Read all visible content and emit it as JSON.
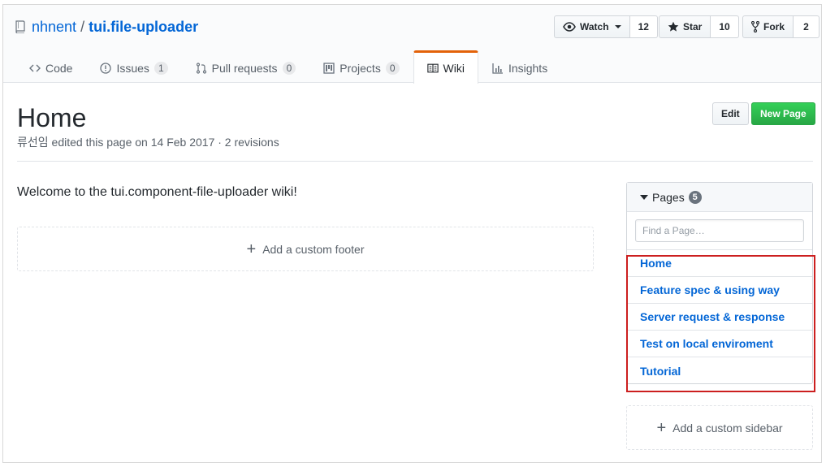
{
  "repo": {
    "owner": "nhnent",
    "separator": "/",
    "name": "tui.file-uploader"
  },
  "actions": {
    "watch_label": "Watch",
    "watch_count": "12",
    "star_label": "Star",
    "star_count": "10",
    "fork_label": "Fork",
    "fork_count": "2"
  },
  "tabs": [
    {
      "label": "Code",
      "icon": "code-icon"
    },
    {
      "label": "Issues",
      "count": "1",
      "icon": "issue-icon"
    },
    {
      "label": "Pull requests",
      "count": "0",
      "icon": "pull-request-icon"
    },
    {
      "label": "Projects",
      "count": "0",
      "icon": "project-icon"
    },
    {
      "label": "Wiki",
      "icon": "book-icon",
      "selected": true
    },
    {
      "label": "Insights",
      "icon": "graph-icon"
    }
  ],
  "page": {
    "title": "Home",
    "meta": "류선임 edited this page on 14 Feb 2017 · 2 revisions",
    "edit_label": "Edit",
    "new_page_label": "New Page",
    "welcome": "Welcome to the tui.component-file-uploader wiki!",
    "add_footer": "Add a custom footer",
    "add_sidebar": "Add a custom sidebar"
  },
  "sidebar": {
    "header": "Pages",
    "count": "5",
    "filter_placeholder": "Find a Page…",
    "pages": [
      "Home",
      "Feature spec & using way",
      "Server request & response",
      "Test on local enviroment",
      "Tutorial"
    ]
  },
  "colors": {
    "link": "#0366d6",
    "tab_accent": "#e36209",
    "primary_button": "#28a745",
    "highlight_box": "#cc1f1f"
  }
}
